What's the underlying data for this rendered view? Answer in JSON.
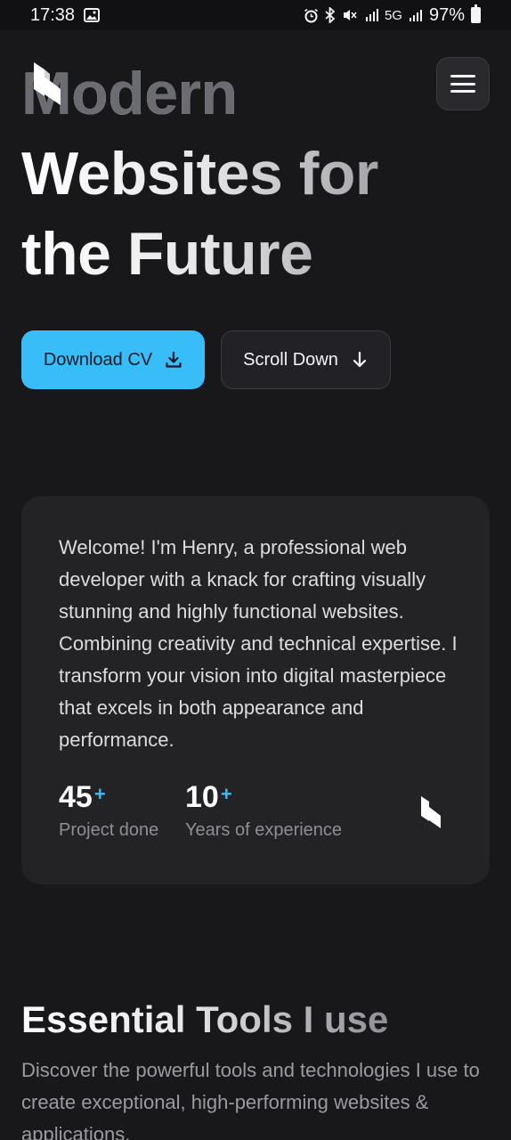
{
  "status_bar": {
    "time": "17:38",
    "battery": "97%",
    "network": "5G"
  },
  "header": {
    "menu_label": "Menu"
  },
  "hero": {
    "title_lines": [
      "Modern",
      "Websites for",
      "the Future"
    ],
    "primary_button": "Download CV",
    "secondary_button": "Scroll Down"
  },
  "about": {
    "text": "Welcome! I'm Henry, a professional web developer with a knack for crafting visually stunning and highly functional websites. Combining creativity and technical expertise. I transform your vision into digital masterpiece that excels in both appearance and performance.",
    "stats": [
      {
        "value": "45",
        "suffix": "+",
        "label": "Project done"
      },
      {
        "value": "10",
        "suffix": "+",
        "label": "Years of experience"
      }
    ]
  },
  "tools": {
    "title": "Essential Tools I use",
    "description": "Discover the powerful tools and technologies I use to create exceptional, high-performing websites & applications."
  },
  "colors": {
    "accent": "#38bdf8",
    "background": "#18181b",
    "card": "#232326"
  }
}
